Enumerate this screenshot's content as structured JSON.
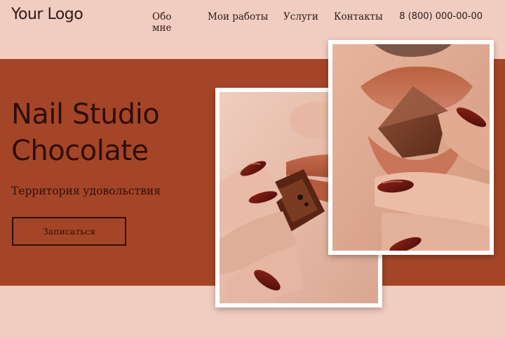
{
  "header": {
    "logo": "Your Logo",
    "nav": [
      "Обо мне",
      "Мои работы",
      "Услуги",
      "Контакты"
    ],
    "phone": "8 (800) 000-00-00"
  },
  "hero": {
    "title_line1": "Nail Studio",
    "title_line2": "Chocolate",
    "subtitle": "Территория удовольствия",
    "cta_label": "Записаться"
  },
  "colors": {
    "background": "#F1CCC0",
    "band": "#A54527",
    "text": "#2F0E08"
  }
}
